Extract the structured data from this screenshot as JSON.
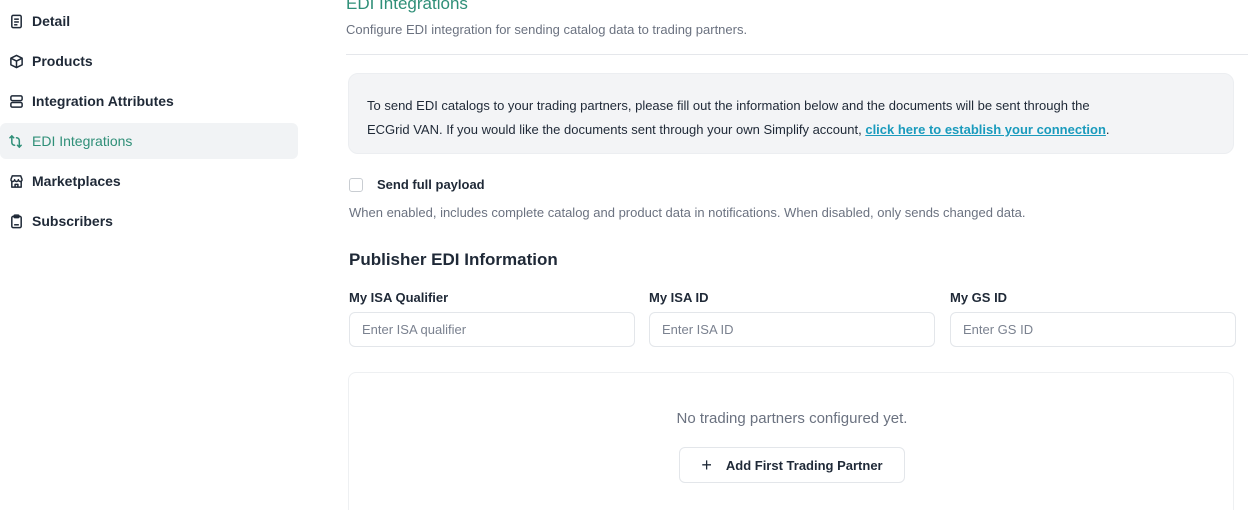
{
  "sidebar": {
    "items": [
      {
        "label": "Detail",
        "icon": "document-icon",
        "active": false
      },
      {
        "label": "Products",
        "icon": "box-icon",
        "active": false
      },
      {
        "label": "Integration Attributes",
        "icon": "server-icon",
        "active": false
      },
      {
        "label": "EDI Integrations",
        "icon": "route-icon",
        "active": true
      },
      {
        "label": "Marketplaces",
        "icon": "store-icon",
        "active": false
      },
      {
        "label": "Subscribers",
        "icon": "clipboard-icon",
        "active": false
      }
    ]
  },
  "header": {
    "title": "EDI Integrations",
    "subtitle": "Configure EDI integration for sending catalog data to trading partners."
  },
  "info": {
    "text_line1": "To send EDI catalogs to your trading partners, please fill out the information below and the documents will be sent through the",
    "text_line2": "ECGrid VAN. If you would like the documents sent through your own Simplify account,",
    "link": "click here to establish your connection",
    "suffix": "."
  },
  "payload": {
    "label": "Send full payload",
    "checked": false,
    "help": "When enabled, includes complete catalog and product data in notifications. When disabled, only sends changed data."
  },
  "publisher": {
    "title": "Publisher EDI Information",
    "fields": [
      {
        "label": "My ISA Qualifier",
        "placeholder": "Enter ISA qualifier",
        "value": ""
      },
      {
        "label": "My ISA ID",
        "placeholder": "Enter ISA ID",
        "value": ""
      },
      {
        "label": "My GS ID",
        "placeholder": "Enter GS ID",
        "value": ""
      }
    ]
  },
  "partners": {
    "empty_text": "No trading partners configured yet.",
    "add_button": "Add First Trading Partner"
  },
  "colors": {
    "accent": "#2f8f78",
    "link": "#1a9bbd",
    "muted": "#6b7280"
  }
}
